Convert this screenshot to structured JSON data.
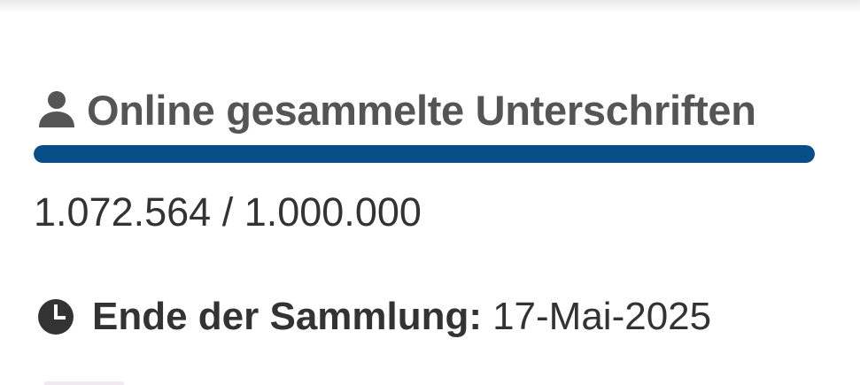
{
  "colors": {
    "progress_fill": "#074d88",
    "heading_text": "#555555",
    "body_text": "#333333"
  },
  "signatures": {
    "icon": "person-icon",
    "title": "Online gesammelte Unterschriften",
    "progress_fraction": 1.0,
    "count": "1.072.564 / 1.000.000"
  },
  "collection_end": {
    "icon": "clock-icon",
    "label": "Ende der Sammlung:",
    "date": "17-Mai-2025"
  }
}
